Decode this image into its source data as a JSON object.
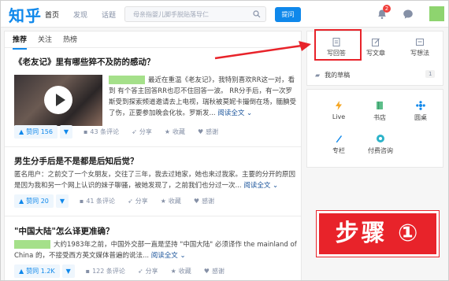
{
  "header": {
    "logo": "知乎",
    "nav": [
      "首页",
      "发现",
      "话题"
    ],
    "search_placeholder": "母亲指婴儿脚手脱贴落导仁",
    "ask_label": "提问",
    "notification_count": "2"
  },
  "tabs": [
    "推荐",
    "关注",
    "热榜"
  ],
  "feed": [
    {
      "title": "《老友记》里有哪些猝不及防的感动？",
      "excerpt_line1": "最近在重温《老友记》，我特别喜欢RR这一对，看到",
      "excerpt_rest": "有个答主回答RR也忍不住回答一波。 RR分手后，有一次罗斯受到探索频道邀请去上电视，瑞秋被莫妮卡撮倒在场，腼腆受了伤，正要参加晚会化妆。罗斯发...",
      "more": "阅读全文",
      "votes": "赞同 156",
      "comments": "43 条评论",
      "share": "分享",
      "collect": "收藏",
      "thanks": "感谢"
    },
    {
      "title": "男生分手后是不是都是后知后觉？",
      "excerpt": "匿名用户：之前交了一个女朋友，交往了三年，我去过她家，她也来过我家。主要的分开的原因是因为我和另一个网上认识的妹子聊骚，被她发现了，之前我们也分过一次...",
      "more": "阅读全文",
      "votes": "赞同 20",
      "comments": "41 条评论",
      "share": "分享",
      "collect": "收藏",
      "thanks": "感谢"
    },
    {
      "title": "\"中国大陆\"怎么译更准确？",
      "excerpt_line1": "大约1983年之前，中国外交部一直是坚持 \"中国大陆\" 必须译作 the mainland of China",
      "excerpt_rest": "的，不接受西方英文媒体普遍的说法...",
      "more": "阅读全文",
      "votes": "赞同 1.2K",
      "comments": "122 条评论",
      "share": "分享",
      "collect": "收藏",
      "thanks": "感谢"
    }
  ],
  "sidebar": {
    "write_answer": "写回答",
    "write_article": "写文章",
    "write_idea": "写想法",
    "drafts": "我的草稿",
    "draft_count": "1",
    "items": [
      "Live",
      "书店",
      "圆桌",
      "专栏",
      "付费咨询"
    ]
  },
  "step_label": "步骤 ①"
}
